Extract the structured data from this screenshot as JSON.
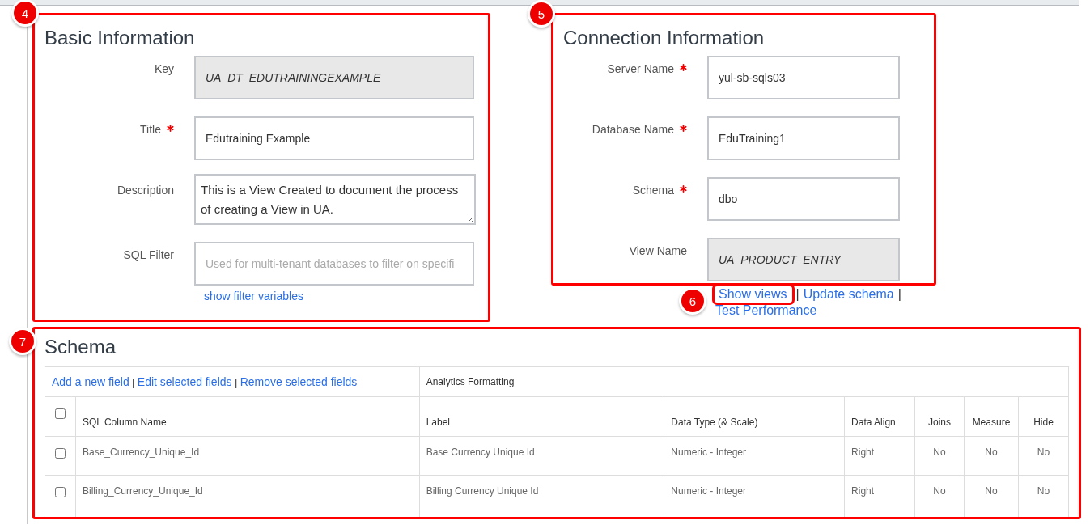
{
  "basic_information": {
    "callout": "4",
    "title": "Basic Information",
    "fields": [
      {
        "label": "Key",
        "required": false,
        "kind": "readonly",
        "value": "UA_DT_EDUTRAININGEXAMPLE"
      },
      {
        "label": "Title",
        "required": true,
        "kind": "input",
        "value": "Edutraining Example"
      },
      {
        "label": "Description",
        "required": false,
        "kind": "textarea",
        "value": "This is a View Created to document the process of creating a View in UA."
      },
      {
        "label": "SQL Filter",
        "required": false,
        "kind": "input",
        "placeholder": "Used for multi-tenant databases to filter on specifi"
      }
    ],
    "link": "show filter variables"
  },
  "connection_information": {
    "callout": "5",
    "title": "Connection Information",
    "fields": [
      {
        "label": "Server Name",
        "required": true,
        "kind": "input",
        "value": "yul-sb-sqls03"
      },
      {
        "label": "Database Name",
        "required": true,
        "kind": "input",
        "value": "EduTraining1"
      },
      {
        "label": "Schema",
        "required": true,
        "kind": "input",
        "value": "dbo"
      },
      {
        "label": "View Name",
        "required": false,
        "kind": "readonly",
        "value": "UA_PRODUCT_ENTRY"
      }
    ]
  },
  "schema_links": {
    "callout": "6",
    "links": [
      {
        "label": "Show views",
        "highlighted": true,
        "separator": "|"
      },
      {
        "label": "Update schema",
        "highlighted": false,
        "separator": "|"
      },
      {
        "label": "Test Performance",
        "highlighted": false
      }
    ]
  },
  "schema": {
    "callout": "7",
    "title": "Schema",
    "actions": [
      {
        "label": "Add a new field",
        "separator": "|"
      },
      {
        "label": "Edit selected fields",
        "separator": "|"
      },
      {
        "label": "Remove selected fields"
      }
    ],
    "group_header": "Analytics Formatting",
    "select_all_checked": false,
    "columns": [
      "SQL Column Name",
      "Label",
      "Data Type (& Scale)",
      "Data Align",
      "Joins",
      "Measure",
      "Hide"
    ],
    "rows": [
      {
        "checked": false,
        "cells": [
          "Base_Currency_Unique_Id",
          "Base Currency Unique Id",
          "Numeric - Integer",
          "Right",
          "No",
          "No",
          "No"
        ]
      },
      {
        "checked": false,
        "cells": [
          "Billing_Currency_Unique_Id",
          "Billing Currency Unique Id",
          "Numeric - Integer",
          "Right",
          "No",
          "No",
          "No"
        ]
      }
    ]
  }
}
